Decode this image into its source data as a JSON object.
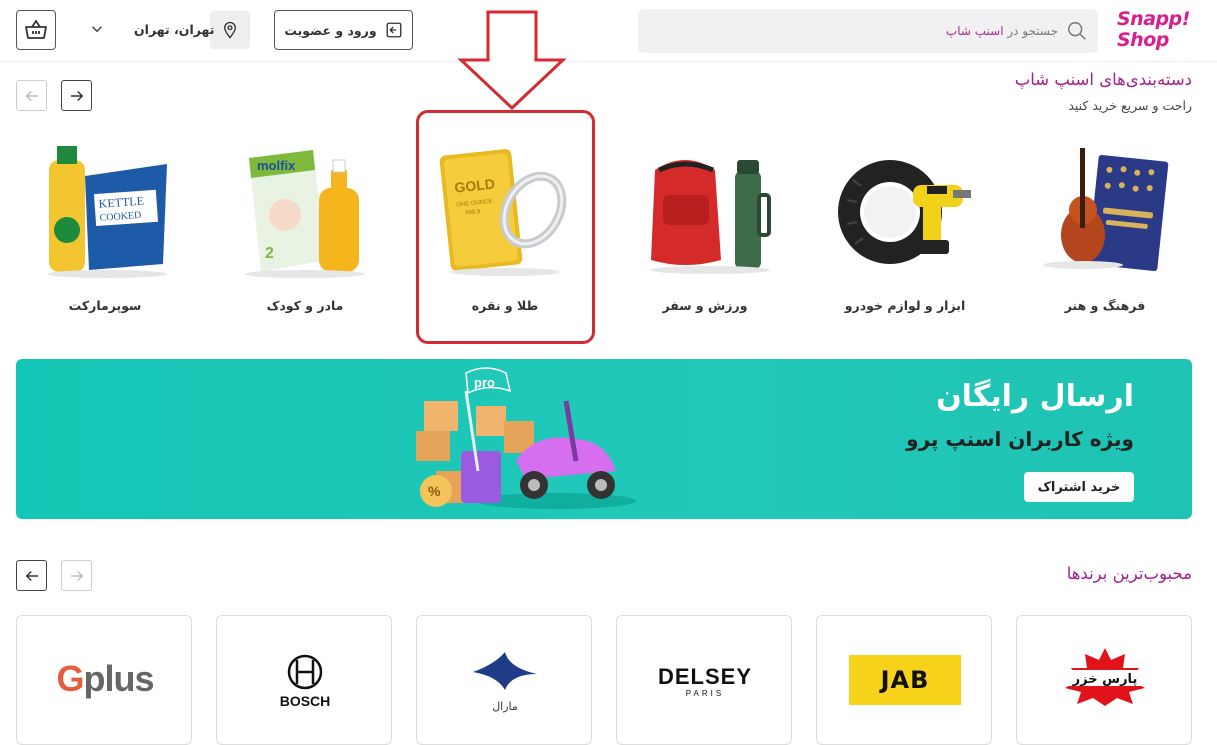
{
  "header": {
    "logo_line1": "Snapp!",
    "logo_line2": "Shop",
    "search_placeholder_prefix": "جستجو در ",
    "search_placeholder_brand": "اسنپ شاپ",
    "login_label": "ورود و عضویت",
    "location_label": "تهران، تهران"
  },
  "categories_section": {
    "title": "دسته‌بندی‌های اسنپ شاپ",
    "subtitle": "راحت و سریع خرید کنید",
    "items": [
      {
        "label": "فرهنگ و هنر",
        "icon": "violin-book-image"
      },
      {
        "label": "ابزار و لوازم خودرو",
        "icon": "tire-drill-image"
      },
      {
        "label": "ورزش و سفر",
        "icon": "backpack-flask-image"
      },
      {
        "label": "طلا و نقره",
        "icon": "gold-bar-ring-image"
      },
      {
        "label": "مادر و کودک",
        "icon": "diapers-shampoo-image"
      },
      {
        "label": "سوپرمارکت",
        "icon": "oil-chips-image"
      }
    ]
  },
  "banner": {
    "title": "ارسال رایگان",
    "subtitle": "ویژه کاربران اسنپ پرو",
    "button_label": "خرید اشتراک",
    "flag_text": "pro"
  },
  "brands_section": {
    "title": "محبوب‌ترین برندها",
    "items": [
      {
        "name": "پارس خزر"
      },
      {
        "name": "JAB"
      },
      {
        "name": "DELSEY",
        "sub": "PARIS"
      },
      {
        "name": "مارال"
      },
      {
        "name": "BOSCH"
      },
      {
        "name": "Gplus"
      }
    ]
  },
  "colors": {
    "brand_purple": "#a1218c",
    "logo_pink": "#d81e8f",
    "banner_teal": "#1ec3b3",
    "highlight_red": "#d42a32"
  }
}
